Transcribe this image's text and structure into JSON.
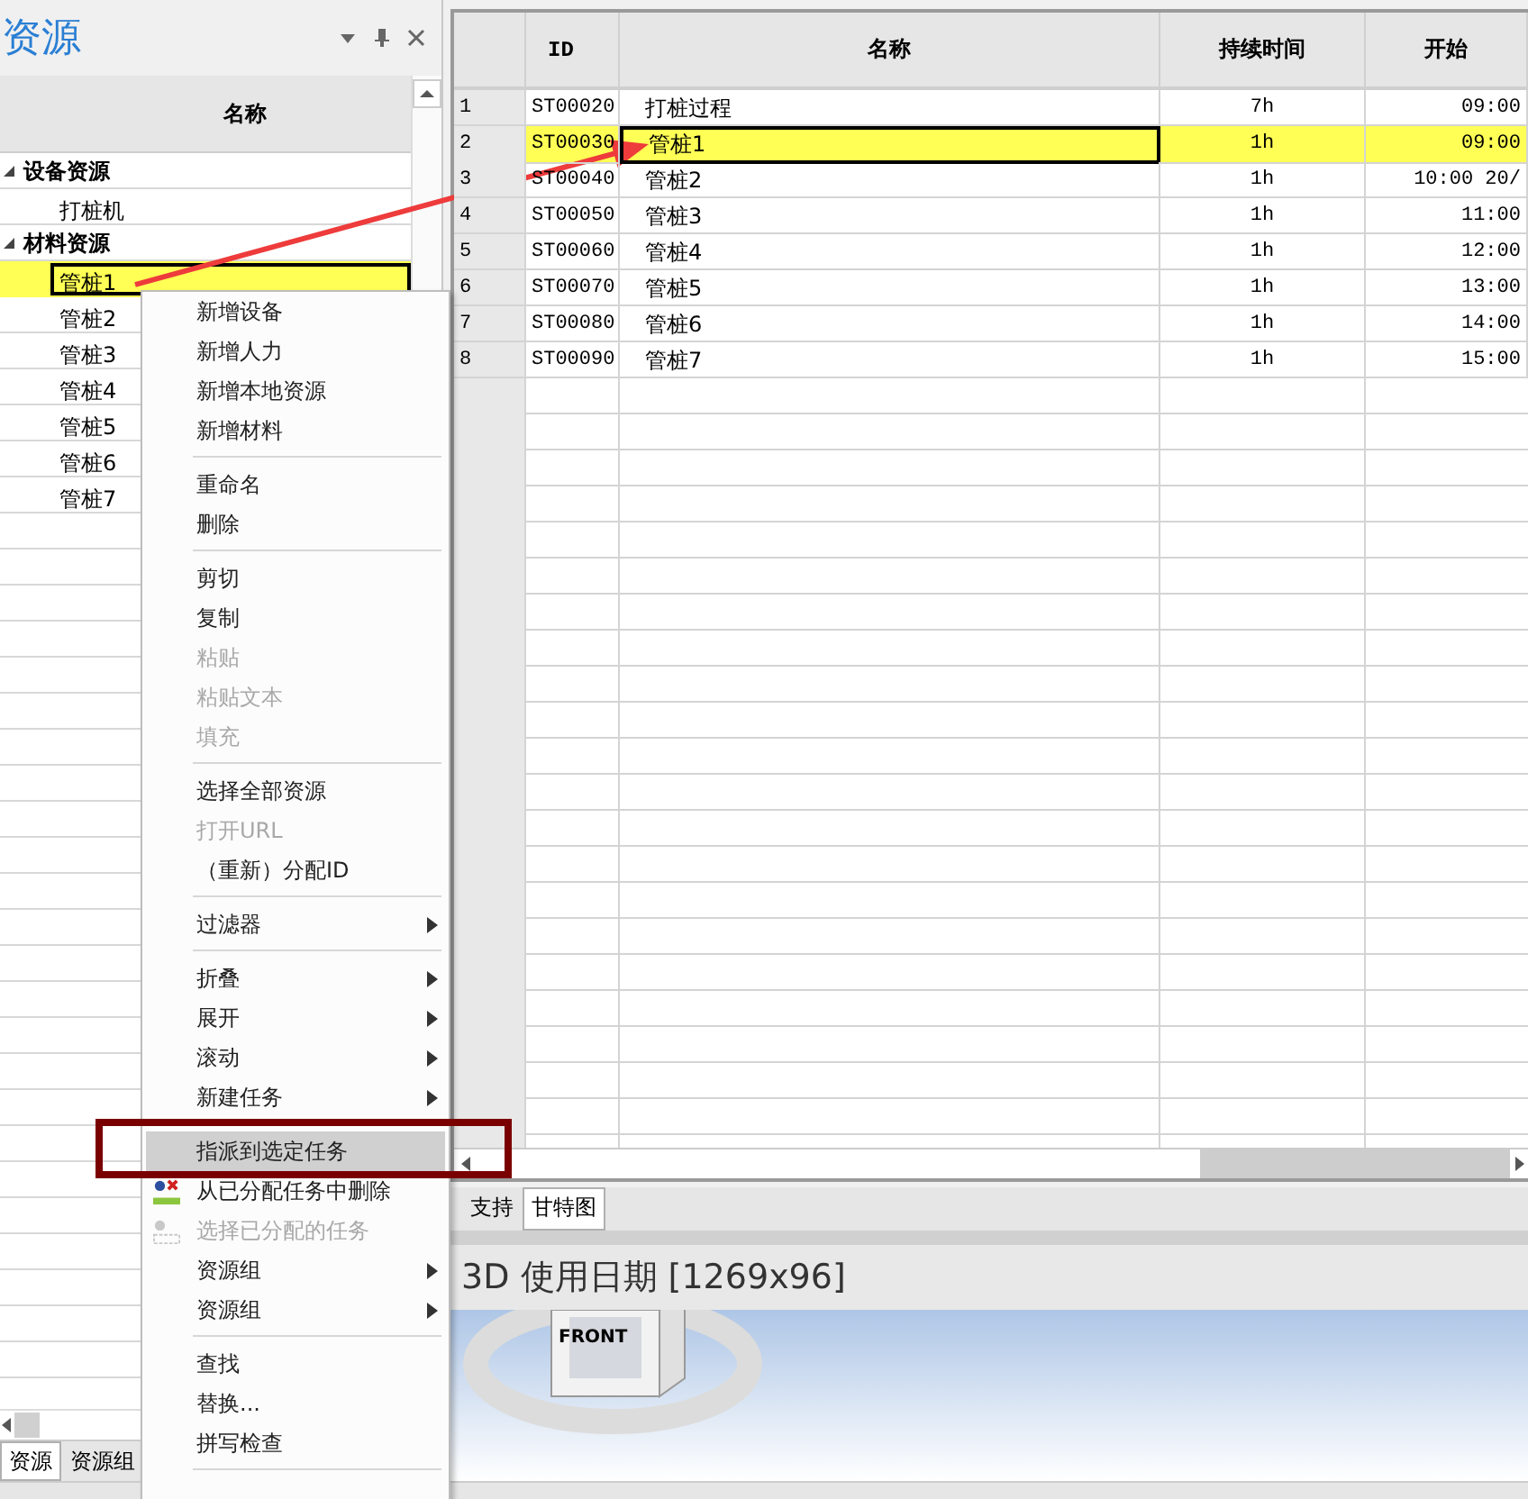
{
  "resource_panel": {
    "title": "资源",
    "column_header": "名称",
    "tree": [
      {
        "label": "设备资源",
        "expanded": true,
        "selected": false,
        "children": [
          {
            "label": "打桩机",
            "selected": false
          }
        ]
      },
      {
        "label": "材料资源",
        "expanded": true,
        "selected": false,
        "children": [
          {
            "label": "管桩1",
            "selected": true
          },
          {
            "label": "管桩2",
            "selected": false
          },
          {
            "label": "管桩3",
            "selected": false
          },
          {
            "label": "管桩4",
            "selected": false
          },
          {
            "label": "管桩5",
            "selected": false
          },
          {
            "label": "管桩6",
            "selected": false
          },
          {
            "label": "管桩7",
            "selected": false
          }
        ]
      }
    ],
    "tabs": [
      {
        "label": "资源",
        "selected": true
      },
      {
        "label": "资源组",
        "selected": false
      }
    ]
  },
  "task_grid": {
    "columns": [
      "ID",
      "名称",
      "持续时间",
      "开始"
    ],
    "rows": [
      {
        "row": "1",
        "id": "ST00020",
        "name": "打桩过程",
        "duration": "7h",
        "start": "09:00",
        "selected": false
      },
      {
        "row": "2",
        "id": "ST00030",
        "name": "管桩1",
        "duration": "1h",
        "start": "09:00",
        "selected": true
      },
      {
        "row": "3",
        "id": "ST00040",
        "name": "管桩2",
        "duration": "1h",
        "start": "10:00 20/",
        "selected": false
      },
      {
        "row": "4",
        "id": "ST00050",
        "name": "管桩3",
        "duration": "1h",
        "start": "11:00",
        "selected": false
      },
      {
        "row": "5",
        "id": "ST00060",
        "name": "管桩4",
        "duration": "1h",
        "start": "12:00",
        "selected": false
      },
      {
        "row": "6",
        "id": "ST00070",
        "name": "管桩5",
        "duration": "1h",
        "start": "13:00",
        "selected": false
      },
      {
        "row": "7",
        "id": "ST00080",
        "name": "管桩6",
        "duration": "1h",
        "start": "14:00",
        "selected": false
      },
      {
        "row": "8",
        "id": "ST00090",
        "name": "管桩7",
        "duration": "1h",
        "start": "15:00",
        "selected": false
      }
    ],
    "tabs": [
      {
        "label": "支持",
        "selected": false
      },
      {
        "label": "甘特图",
        "selected": true
      }
    ]
  },
  "view_3d": {
    "title": "3D 使用日期  [1269x96]",
    "cube_label": "FRONT"
  },
  "context_menu": [
    {
      "kind": "item",
      "label": "新增设备",
      "disabled": false,
      "highlighted": false
    },
    {
      "kind": "item",
      "label": "新增人力",
      "disabled": false,
      "highlighted": false
    },
    {
      "kind": "item",
      "label": "新增本地资源",
      "disabled": false,
      "highlighted": false
    },
    {
      "kind": "item",
      "label": "新增材料",
      "disabled": false,
      "highlighted": false
    },
    {
      "kind": "separator"
    },
    {
      "kind": "item",
      "label": "重命名",
      "disabled": false,
      "highlighted": false
    },
    {
      "kind": "item",
      "label": "删除",
      "disabled": false,
      "highlighted": false
    },
    {
      "kind": "separator"
    },
    {
      "kind": "item",
      "label": "剪切",
      "disabled": false,
      "highlighted": false
    },
    {
      "kind": "item",
      "label": "复制",
      "disabled": false,
      "highlighted": false
    },
    {
      "kind": "item",
      "label": "粘贴",
      "disabled": true,
      "highlighted": false
    },
    {
      "kind": "item",
      "label": "粘贴文本",
      "disabled": true,
      "highlighted": false
    },
    {
      "kind": "item",
      "label": "填充",
      "disabled": true,
      "highlighted": false
    },
    {
      "kind": "separator"
    },
    {
      "kind": "item",
      "label": "选择全部资源",
      "disabled": false,
      "highlighted": false
    },
    {
      "kind": "item",
      "label": "打开URL",
      "disabled": true,
      "highlighted": false
    },
    {
      "kind": "item",
      "label": "（重新）分配ID",
      "disabled": false,
      "highlighted": false
    },
    {
      "kind": "separator"
    },
    {
      "kind": "submenu",
      "label": "过滤器",
      "disabled": false,
      "highlighted": false
    },
    {
      "kind": "separator"
    },
    {
      "kind": "submenu",
      "label": "折叠",
      "disabled": false,
      "highlighted": false
    },
    {
      "kind": "submenu",
      "label": "展开",
      "disabled": false,
      "highlighted": false
    },
    {
      "kind": "submenu",
      "label": "滚动",
      "disabled": false,
      "highlighted": false
    },
    {
      "kind": "submenu",
      "label": "新建任务",
      "disabled": false,
      "highlighted": false
    },
    {
      "kind": "separator"
    },
    {
      "kind": "item",
      "label": "指派到选定任务",
      "disabled": false,
      "highlighted": true
    },
    {
      "kind": "iconitem",
      "label": "从已分配任务中删除",
      "disabled": false,
      "highlighted": false
    },
    {
      "kind": "iconitem",
      "label": "选择已分配的任务",
      "disabled": true,
      "highlighted": false
    },
    {
      "kind": "submenu",
      "label": "资源组",
      "disabled": false,
      "highlighted": false
    },
    {
      "kind": "submenu",
      "label": "资源组",
      "disabled": false,
      "highlighted": false
    },
    {
      "kind": "separator"
    },
    {
      "kind": "item",
      "label": "查找",
      "disabled": false,
      "highlighted": false
    },
    {
      "kind": "item",
      "label": "替换...",
      "disabled": false,
      "highlighted": false
    },
    {
      "kind": "item",
      "label": "拼写检查",
      "disabled": false,
      "highlighted": false
    },
    {
      "kind": "separator"
    }
  ]
}
